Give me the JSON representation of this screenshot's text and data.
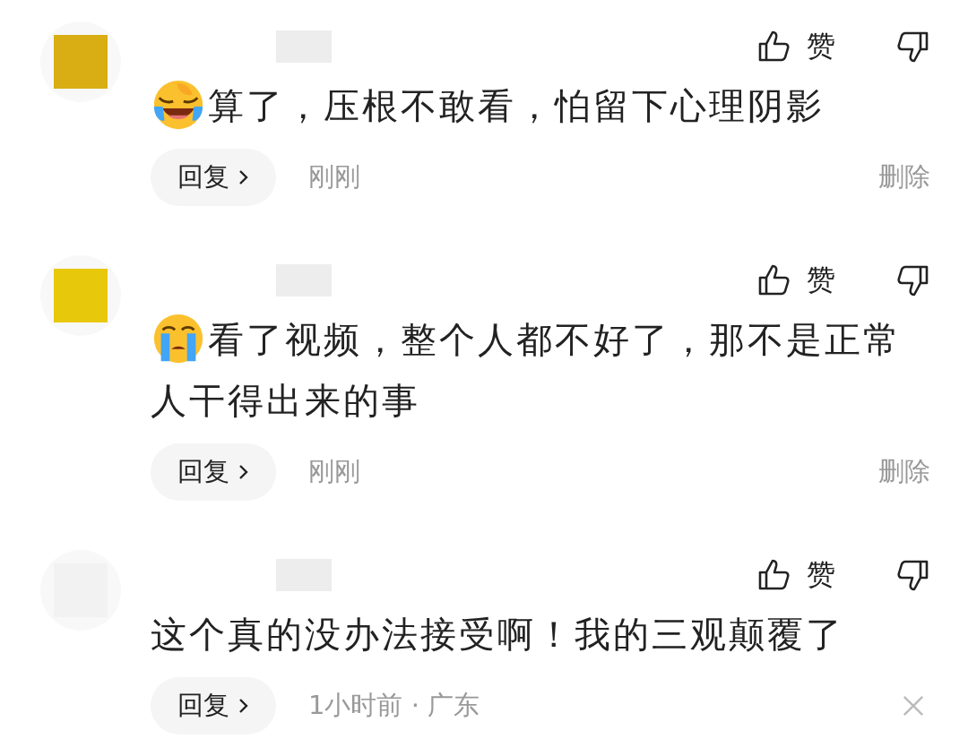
{
  "comments": [
    {
      "avatar": {
        "color": "#d9ad14"
      },
      "emoji": {
        "kind": "laughing-crying"
      },
      "text": "算了，压根不敢看，怕留下心理阴影",
      "like_label": "赞",
      "reply_label": "回复",
      "time": "刚刚",
      "action": {
        "kind": "delete",
        "label": "删除"
      }
    },
    {
      "avatar": {
        "color": "#e8c80a"
      },
      "emoji": {
        "kind": "crying"
      },
      "text": "看了视频，整个人都不好了，那不是正常人干得出来的事",
      "like_label": "赞",
      "reply_label": "回复",
      "time": "刚刚",
      "action": {
        "kind": "delete",
        "label": "删除"
      }
    },
    {
      "avatar": {
        "color": "#f2f2f2"
      },
      "text": "这个真的没办法接受啊！我的三观颠覆了",
      "like_label": "赞",
      "reply_label": "回复",
      "time": "1小时前 · 广东",
      "action": {
        "kind": "dismiss"
      }
    }
  ]
}
